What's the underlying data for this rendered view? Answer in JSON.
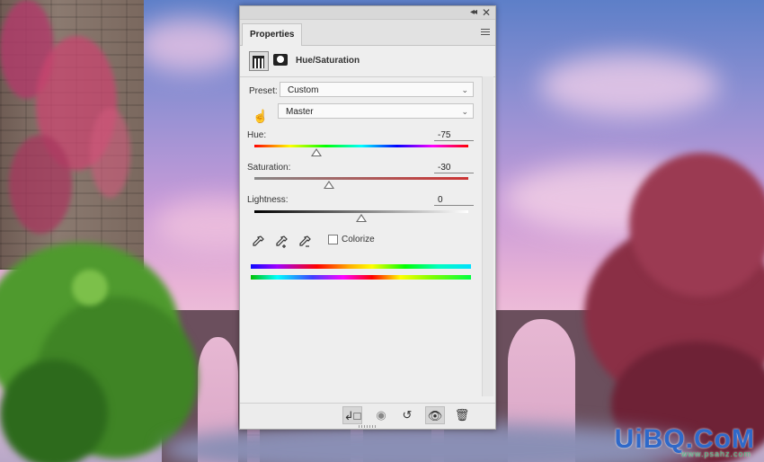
{
  "panel": {
    "title_tab": "Properties",
    "header_title": "Hue/Saturation",
    "preset_label": "Preset:",
    "preset_value": "Custom",
    "channel_value": "Master",
    "hue_label": "Hue:",
    "hue_value": "-75",
    "saturation_label": "Saturation:",
    "saturation_value": "-30",
    "lightness_label": "Lightness:",
    "lightness_value": "0",
    "colorize_label": "Colorize"
  },
  "sliders": {
    "hue": -75,
    "saturation": -30,
    "lightness": 0
  },
  "footer": {
    "buttons": [
      "clip-to-layer-icon",
      "view-previous-state-icon",
      "reset-icon",
      "visibility-eye-icon",
      "trash-icon"
    ]
  },
  "watermark": {
    "text": "UiBQ.CoM",
    "sub": "www.psahz.com"
  }
}
